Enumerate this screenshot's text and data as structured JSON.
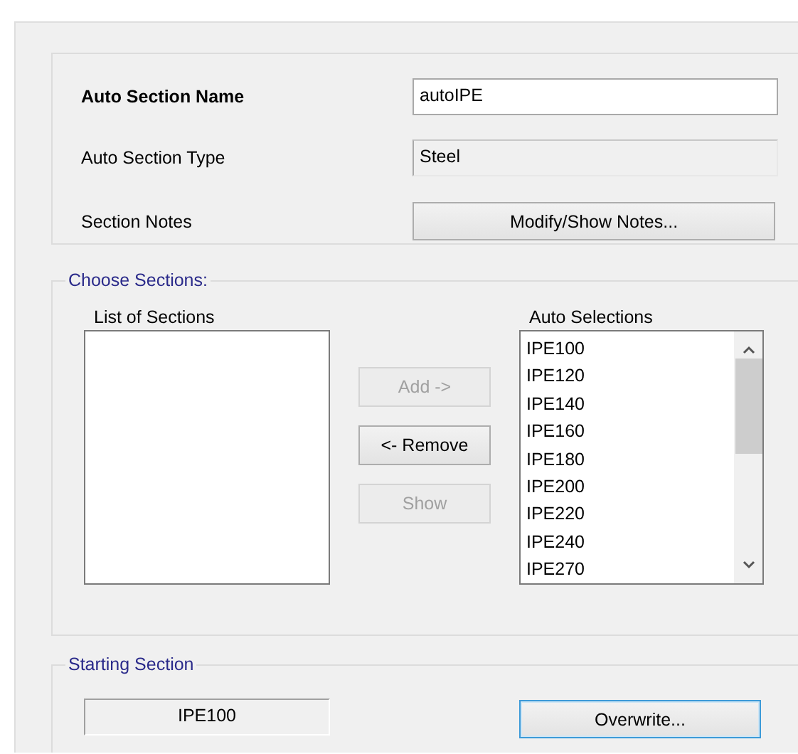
{
  "section_properties": {
    "fields": [
      {
        "label": "Auto Section Name",
        "bold": true,
        "kind": "input",
        "value": "autoIPE"
      },
      {
        "label": "Auto Section Type",
        "bold": false,
        "kind": "readonly",
        "value": "Steel"
      },
      {
        "label": "Section Notes",
        "bold": false,
        "kind": "button",
        "value": "Modify/Show Notes..."
      }
    ]
  },
  "choose_sections": {
    "title": "Choose Sections:",
    "list_of_sections": {
      "label": "List of Sections"
    },
    "buttons": [
      {
        "label": "Add ->",
        "disabled": true
      },
      {
        "label": "<- Remove",
        "disabled": false
      },
      {
        "label": "Show",
        "disabled": true
      }
    ],
    "auto_selections": {
      "label": "Auto Selections",
      "items": [
        "IPE100",
        "IPE120",
        "IPE140",
        "IPE160",
        "IPE180",
        "IPE200",
        "IPE220",
        "IPE240",
        "IPE270"
      ]
    }
  },
  "starting_section": {
    "title": "Starting Section",
    "value": "IPE100",
    "button": {
      "label": "Overwrite...",
      "default": true
    }
  }
}
